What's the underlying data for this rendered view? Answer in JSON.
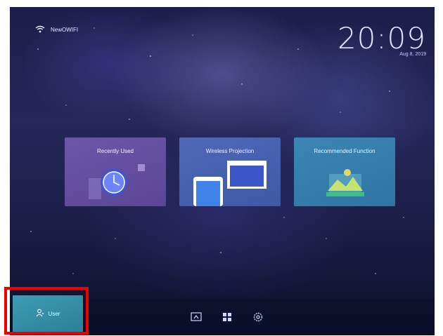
{
  "status": {
    "wifi_icon": "wifi-icon",
    "network_name": "NewOWIFI"
  },
  "clock": {
    "time": "20:09",
    "date": "Aug 8, 2019"
  },
  "tiles": [
    {
      "label": "Recently Used",
      "icon": "clock-icon"
    },
    {
      "label": "Wireless Projection",
      "icon": "phone-screen-icon"
    },
    {
      "label": "Recommended Function",
      "icon": "landscape-icon"
    }
  ],
  "dock": {
    "user_label": "User",
    "user_icon": "user-icon",
    "icons": [
      "input-source-icon",
      "apps-grid-icon",
      "settings-icon"
    ]
  },
  "colors": {
    "highlight": "#ee0000"
  }
}
